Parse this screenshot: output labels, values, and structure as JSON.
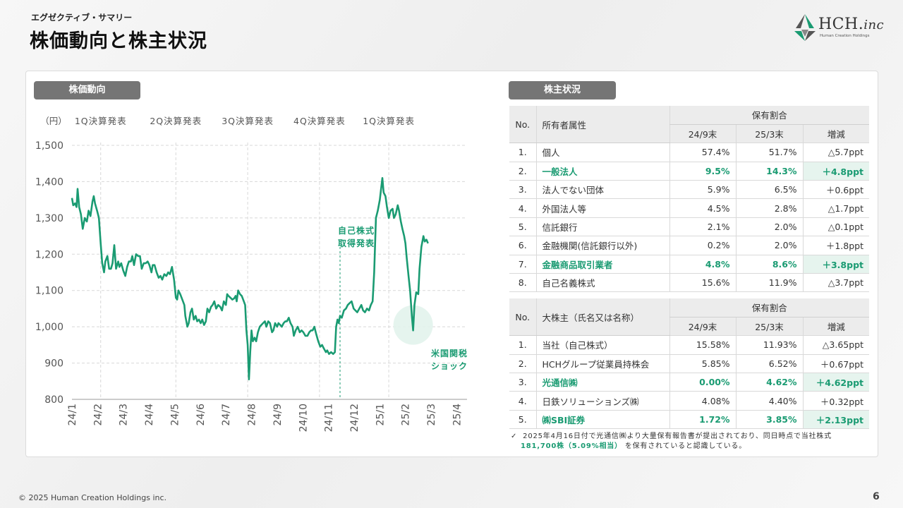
{
  "header": {
    "subtitle": "エグゼクティブ・サマリー",
    "title": "株価動向と株主状況"
  },
  "logo": {
    "main": "HCH.",
    "inc": "inc",
    "sub": "Human Creation Holdings"
  },
  "colors": {
    "accent": "#1a9b72",
    "label_bg": "#757575",
    "highlight_bg": "#e6f4ee"
  },
  "icons": {
    "logo": "hch-leaf-logo-icon",
    "note_mark": "check-icon"
  },
  "left_label": "株価動向",
  "right_label": "株主状況",
  "chart_data": {
    "type": "line",
    "ylabel": "（円）",
    "ylim": [
      800,
      1500
    ],
    "yticks": [
      800,
      900,
      "1,000",
      "1,100",
      "1,200",
      "1,300",
      "1,400",
      "1,500"
    ],
    "x_ticks": [
      "24/1",
      "24/2",
      "24/3",
      "24/4",
      "24/5",
      "24/6",
      "24/7",
      "24/8",
      "24/9",
      "24/10",
      "24/11",
      "24/12",
      "25/1",
      "25/2",
      "25/3",
      "25/4"
    ],
    "event_lines": [
      {
        "label": "1Q決算発表",
        "x": 1.12
      },
      {
        "label": "2Q決算発表",
        "x": 4.05
      },
      {
        "label": "3Q決算発表",
        "x": 6.85
      },
      {
        "label": "4Q決算発表",
        "x": 9.65
      },
      {
        "label": "1Q決算発表",
        "x": 12.35
      }
    ],
    "annotations": {
      "buyback": "自己株式\n取得発表",
      "tariff": "米国関税\nショック"
    },
    "series": [
      {
        "values": [
          [
            0.0,
            1355
          ],
          [
            0.05,
            1335
          ],
          [
            0.12,
            1340
          ],
          [
            0.18,
            1330
          ],
          [
            0.22,
            1380
          ],
          [
            0.28,
            1330
          ],
          [
            0.35,
            1310
          ],
          [
            0.42,
            1270
          ],
          [
            0.5,
            1300
          ],
          [
            0.58,
            1290
          ],
          [
            0.65,
            1320
          ],
          [
            0.72,
            1305
          ],
          [
            0.8,
            1345
          ],
          [
            0.85,
            1360
          ],
          [
            0.9,
            1340
          ],
          [
            0.98,
            1320
          ],
          [
            1.05,
            1300
          ],
          [
            1.12,
            1230
          ],
          [
            1.18,
            1175
          ],
          [
            1.25,
            1150
          ],
          [
            1.3,
            1180
          ],
          [
            1.38,
            1195
          ],
          [
            1.45,
            1160
          ],
          [
            1.52,
            1160
          ],
          [
            1.58,
            1175
          ],
          [
            1.65,
            1225
          ],
          [
            1.72,
            1160
          ],
          [
            1.8,
            1180
          ],
          [
            1.85,
            1165
          ],
          [
            1.92,
            1175
          ],
          [
            2.0,
            1155
          ],
          [
            2.08,
            1140
          ],
          [
            2.15,
            1165
          ],
          [
            2.22,
            1180
          ],
          [
            2.3,
            1180
          ],
          [
            2.35,
            1195
          ],
          [
            2.42,
            1170
          ],
          [
            2.5,
            1200
          ],
          [
            2.58,
            1195
          ],
          [
            2.65,
            1195
          ],
          [
            2.72,
            1160
          ],
          [
            2.8,
            1175
          ],
          [
            2.88,
            1175
          ],
          [
            2.95,
            1180
          ],
          [
            3.02,
            1170
          ],
          [
            3.1,
            1150
          ],
          [
            3.15,
            1170
          ],
          [
            3.22,
            1170
          ],
          [
            3.3,
            1150
          ],
          [
            3.38,
            1135
          ],
          [
            3.45,
            1140
          ],
          [
            3.52,
            1130
          ],
          [
            3.6,
            1145
          ],
          [
            3.68,
            1140
          ],
          [
            3.75,
            1150
          ],
          [
            3.82,
            1145
          ],
          [
            3.9,
            1165
          ],
          [
            3.98,
            1130
          ],
          [
            4.05,
            1080
          ],
          [
            4.1,
            1075
          ],
          [
            4.15,
            1100
          ],
          [
            4.22,
            1090
          ],
          [
            4.3,
            1075
          ],
          [
            4.38,
            1060
          ],
          [
            4.42,
            1030
          ],
          [
            4.5,
            1000
          ],
          [
            4.55,
            1010
          ],
          [
            4.62,
            1040
          ],
          [
            4.68,
            1050
          ],
          [
            4.75,
            1020
          ],
          [
            4.82,
            1030
          ],
          [
            4.88,
            1015
          ],
          [
            4.95,
            1020
          ],
          [
            5.02,
            1010
          ],
          [
            5.08,
            1020
          ],
          [
            5.15,
            1005
          ],
          [
            5.22,
            1015
          ],
          [
            5.28,
            1050
          ],
          [
            5.35,
            1040
          ],
          [
            5.42,
            1055
          ],
          [
            5.48,
            1060
          ],
          [
            5.55,
            1070
          ],
          [
            5.62,
            1050
          ],
          [
            5.7,
            1060
          ],
          [
            5.78,
            1055
          ],
          [
            5.85,
            1045
          ],
          [
            5.92,
            1070
          ],
          [
            6.0,
            1060
          ],
          [
            6.05,
            1090
          ],
          [
            6.1,
            1085
          ],
          [
            6.18,
            1080
          ],
          [
            6.25,
            1075
          ],
          [
            6.32,
            1078
          ],
          [
            6.38,
            1085
          ],
          [
            6.42,
            1070
          ],
          [
            6.48,
            1100
          ],
          [
            6.55,
            1090
          ],
          [
            6.62,
            1085
          ],
          [
            6.7,
            1070
          ],
          [
            6.75,
            1060
          ],
          [
            6.8,
            990
          ],
          [
            6.85,
            950
          ],
          [
            6.9,
            855
          ],
          [
            6.95,
            930
          ],
          [
            7.0,
            990
          ],
          [
            7.05,
            960
          ],
          [
            7.12,
            970
          ],
          [
            7.18,
            960
          ],
          [
            7.25,
            985
          ],
          [
            7.32,
            1000
          ],
          [
            7.38,
            1005
          ],
          [
            7.45,
            1010
          ],
          [
            7.52,
            1015
          ],
          [
            7.58,
            1000
          ],
          [
            7.65,
            1015
          ],
          [
            7.72,
            1010
          ],
          [
            7.8,
            985
          ],
          [
            7.85,
            990
          ],
          [
            7.92,
            1010
          ],
          [
            8.0,
            1000
          ],
          [
            8.05,
            1010
          ],
          [
            8.12,
            1005
          ],
          [
            8.18,
            1000
          ],
          [
            8.25,
            1010
          ],
          [
            8.32,
            1015
          ],
          [
            8.38,
            1015
          ],
          [
            8.45,
            1025
          ],
          [
            8.52,
            1010
          ],
          [
            8.6,
            1000
          ],
          [
            8.65,
            975
          ],
          [
            8.72,
            990
          ],
          [
            8.8,
            1000
          ],
          [
            8.88,
            985
          ],
          [
            8.95,
            990
          ],
          [
            9.02,
            985
          ],
          [
            9.1,
            975
          ],
          [
            9.18,
            975
          ],
          [
            9.25,
            985
          ],
          [
            9.32,
            990
          ],
          [
            9.38,
            990
          ],
          [
            9.45,
            1000
          ],
          [
            9.52,
            980
          ],
          [
            9.6,
            960
          ],
          [
            9.68,
            945
          ],
          [
            9.75,
            950
          ],
          [
            9.82,
            940
          ],
          [
            9.9,
            930
          ],
          [
            9.95,
            935
          ],
          [
            10.02,
            925
          ],
          [
            10.1,
            930
          ],
          [
            10.18,
            925
          ],
          [
            10.25,
            930
          ],
          [
            10.3,
            1000
          ],
          [
            10.35,
            1020
          ],
          [
            10.4,
            1010
          ],
          [
            10.45,
            1030
          ],
          [
            10.52,
            1025
          ],
          [
            10.6,
            1045
          ],
          [
            10.68,
            1050
          ],
          [
            10.75,
            1060
          ],
          [
            10.82,
            1065
          ],
          [
            10.9,
            1070
          ],
          [
            10.98,
            1050
          ],
          [
            11.05,
            1045
          ],
          [
            11.12,
            1040
          ],
          [
            11.2,
            1050
          ],
          [
            11.28,
            1060
          ],
          [
            11.35,
            1045
          ],
          [
            11.42,
            1040
          ],
          [
            11.5,
            1050
          ],
          [
            11.58,
            1045
          ],
          [
            11.65,
            1060
          ],
          [
            11.72,
            1070
          ],
          [
            11.78,
            1150
          ],
          [
            11.85,
            1300
          ],
          [
            11.92,
            1320
          ],
          [
            12.0,
            1350
          ],
          [
            12.05,
            1380
          ],
          [
            12.1,
            1410
          ],
          [
            12.15,
            1370
          ],
          [
            12.22,
            1360
          ],
          [
            12.28,
            1330
          ],
          [
            12.35,
            1300
          ],
          [
            12.42,
            1320
          ],
          [
            12.5,
            1325
          ],
          [
            12.55,
            1300
          ],
          [
            12.62,
            1310
          ],
          [
            12.7,
            1335
          ],
          [
            12.75,
            1320
          ],
          [
            12.82,
            1290
          ],
          [
            12.88,
            1270
          ],
          [
            12.95,
            1250
          ],
          [
            13.0,
            1230
          ],
          [
            13.05,
            1190
          ],
          [
            13.12,
            1140
          ],
          [
            13.18,
            1100
          ],
          [
            13.25,
            1030
          ],
          [
            13.3,
            990
          ],
          [
            13.35,
            1060
          ],
          [
            13.42,
            1095
          ],
          [
            13.5,
            1090
          ],
          [
            13.55,
            1160
          ],
          [
            13.62,
            1220
          ],
          [
            13.7,
            1250
          ],
          [
            13.75,
            1235
          ],
          [
            13.82,
            1240
          ],
          [
            13.88,
            1230
          ]
        ]
      }
    ]
  },
  "shareholder_table": {
    "headers": {
      "no": "No.",
      "owner": "所有者属性",
      "ratio": "保有割合",
      "c1": "24/9末",
      "c2": "25/3末",
      "diff": "増減"
    },
    "rows": [
      {
        "no": "1.",
        "name": "個人",
        "a": "57.4%",
        "b": "51.7%",
        "d": "△5.7ppt"
      },
      {
        "no": "2.",
        "name": "一般法人",
        "a": "9.5%",
        "b": "14.3%",
        "d": "＋4.8ppt"
      },
      {
        "no": "3.",
        "name": "法人でない団体",
        "a": "5.9%",
        "b": "6.5%",
        "d": "＋0.6ppt"
      },
      {
        "no": "4.",
        "name": "外国法人等",
        "a": "4.5%",
        "b": "2.8%",
        "d": "△1.7ppt"
      },
      {
        "no": "5.",
        "name": "信託銀行",
        "a": "2.1%",
        "b": "2.0%",
        "d": "△0.1ppt"
      },
      {
        "no": "6.",
        "name": "金融機関(信託銀行以外)",
        "a": "0.2%",
        "b": "2.0%",
        "d": "＋1.8ppt"
      },
      {
        "no": "7.",
        "name": "金融商品取引業者",
        "a": "4.8%",
        "b": "8.6%",
        "d": "＋3.8ppt"
      },
      {
        "no": "8.",
        "name": "自己名義株式",
        "a": "15.6%",
        "b": "11.9%",
        "d": "△3.7ppt"
      }
    ]
  },
  "major_table": {
    "headers": {
      "no": "No.",
      "owner": "大株主（氏名又は名称）",
      "ratio": "保有割合",
      "c1": "24/9末",
      "c2": "25/3末",
      "diff": "増減"
    },
    "rows": [
      {
        "no": "1.",
        "name": "当社（自己株式）",
        "a": "15.58%",
        "b": "11.93%",
        "d": "△3.65ppt"
      },
      {
        "no": "2.",
        "name": "HCHグループ従業員持株会",
        "a": "5.85%",
        "b": "6.52%",
        "d": "＋0.67ppt"
      },
      {
        "no": "3.",
        "name": "光通信㈱",
        "a": "0.00%",
        "b": "4.62%",
        "d": "＋4.62ppt"
      },
      {
        "no": "4.",
        "name": "日鉄ソリューションズ㈱",
        "a": "4.08%",
        "b": "4.40%",
        "d": "＋0.32ppt"
      },
      {
        "no": "5.",
        "name": "㈱SBI証券",
        "a": "1.72%",
        "b": "3.85%",
        "d": "＋2.13ppt"
      }
    ]
  },
  "note": {
    "mark": "✓",
    "line1": "2025年4月16日付で光通信㈱より大量保有報告書が提出されており、同日時点で当社株式",
    "em": "181,700株（5.09%相当）",
    "line2": "を保有されていると認識している。"
  },
  "footer": "© 2025 Human Creation Holdings inc.",
  "page": "6"
}
